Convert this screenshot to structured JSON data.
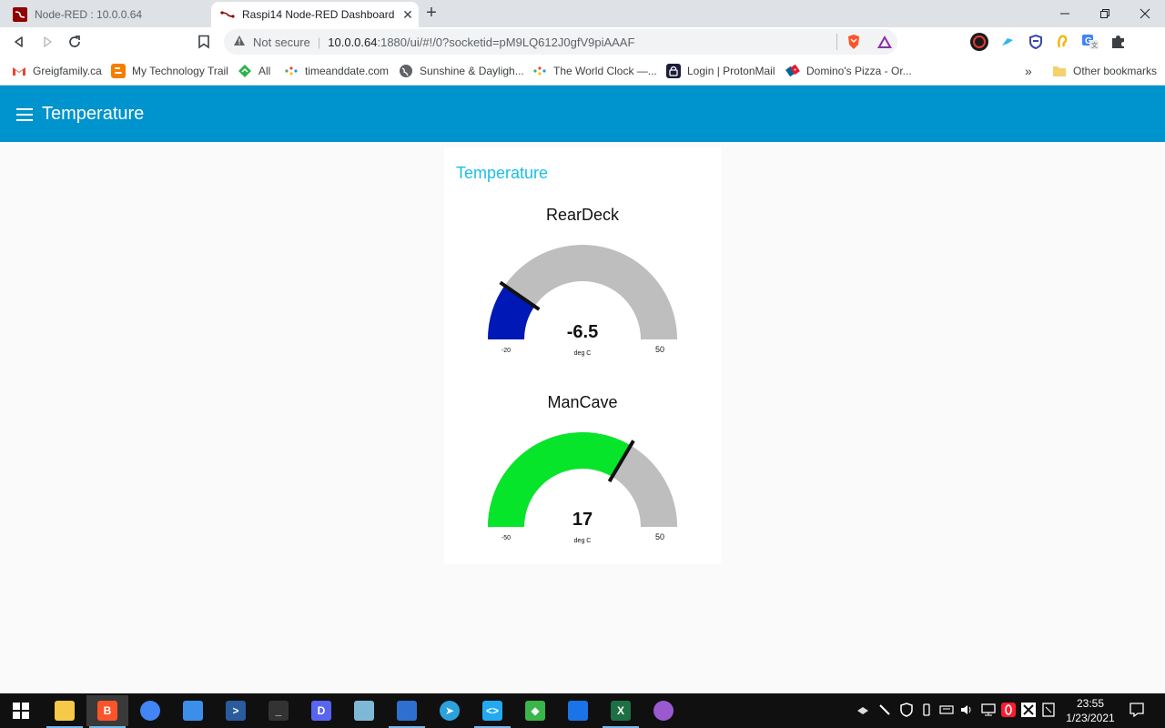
{
  "browser": {
    "tabs": [
      {
        "title": "Node-RED : 10.0.0.64",
        "active": false
      },
      {
        "title": "Raspi14 Node-RED Dashboard",
        "active": true
      }
    ],
    "address": {
      "security_label": "Not secure",
      "url_host": "10.0.0.64",
      "url_rest": ":1880/ui/#!/0?socketid=pM9LQ612J0gfV9piAAAF"
    },
    "bookmarks": [
      {
        "label": "Greigfamily.ca",
        "icon": "gmail-icon",
        "color": "#ea4335"
      },
      {
        "label": "My Technology Trail",
        "icon": "blogger-icon",
        "color": "#f57d00"
      },
      {
        "label": "All",
        "icon": "feedly-icon",
        "color": "#2bb24c"
      },
      {
        "label": "timeanddate.com",
        "icon": "dots-icon",
        "color": "#4caf50"
      },
      {
        "label": "Sunshine & Dayligh...",
        "icon": "globe-icon",
        "color": "#5f6368"
      },
      {
        "label": "The World Clock —...",
        "icon": "dots-icon",
        "color": "#4caf50"
      },
      {
        "label": "Login | ProtonMail",
        "icon": "proton-icon",
        "color": "#1c1b3a"
      },
      {
        "label": "Domino's Pizza - Or...",
        "icon": "dominos-icon",
        "color": "#006491"
      }
    ],
    "overflow_label": "»",
    "other_bookmarks_label": "Other bookmarks"
  },
  "dashboard": {
    "header_title": "Temperature",
    "group_title": "Temperature",
    "gauges": [
      {
        "label": "RearDeck",
        "value": -6.5,
        "display_value": "-6.5",
        "units": "deg C",
        "min": -20,
        "max": 50,
        "min_label": "-20",
        "max_label": "50",
        "fill_color": "#0018b5",
        "track_color": "#bebebe"
      },
      {
        "label": "ManCave",
        "value": 17,
        "display_value": "17",
        "units": "deg C",
        "min": -50,
        "max": 50,
        "min_label": "-50",
        "max_label": "50",
        "fill_color": "#06e52a",
        "track_color": "#bebebe"
      }
    ]
  },
  "taskbar": {
    "apps": [
      {
        "name": "file-explorer",
        "icon": "folder-icon",
        "color": "#f7c948",
        "running": true
      },
      {
        "name": "brave",
        "icon": "brave-icon",
        "color": "#fb542b",
        "running": true,
        "current": true
      },
      {
        "name": "chrome",
        "icon": "chrome-icon",
        "color": "#4285f4",
        "running": false
      },
      {
        "name": "rdp",
        "icon": "remote-desktop-icon",
        "color": "#3b8eea",
        "running": false
      },
      {
        "name": "powershell",
        "icon": "powershell-icon",
        "color": "#2a5b9c",
        "running": false
      },
      {
        "name": "terminal",
        "icon": "terminal-icon",
        "color": "#333333",
        "running": false
      },
      {
        "name": "discord",
        "icon": "discord-icon",
        "color": "#5865f2",
        "running": false
      },
      {
        "name": "notepad",
        "icon": "notepad-icon",
        "color": "#7fb8d6",
        "running": false
      },
      {
        "name": "network",
        "icon": "network-icon",
        "color": "#2f6fd0",
        "running": true
      },
      {
        "name": "telegram",
        "icon": "telegram-icon",
        "color": "#2aa3dd",
        "running": false
      },
      {
        "name": "vscode",
        "icon": "vscode-icon",
        "color": "#23a9f2",
        "running": true
      },
      {
        "name": "git",
        "icon": "git-icon",
        "color": "#39b54a",
        "running": false
      },
      {
        "name": "window",
        "icon": "window-icon",
        "color": "#1a73e8",
        "running": false
      },
      {
        "name": "excel",
        "icon": "excel-icon",
        "color": "#1d7044",
        "running": true
      },
      {
        "name": "ink",
        "icon": "drop-icon",
        "color": "#9b59d0",
        "running": false
      }
    ],
    "clock_time": "23:55",
    "clock_date": "1/23/2021"
  }
}
